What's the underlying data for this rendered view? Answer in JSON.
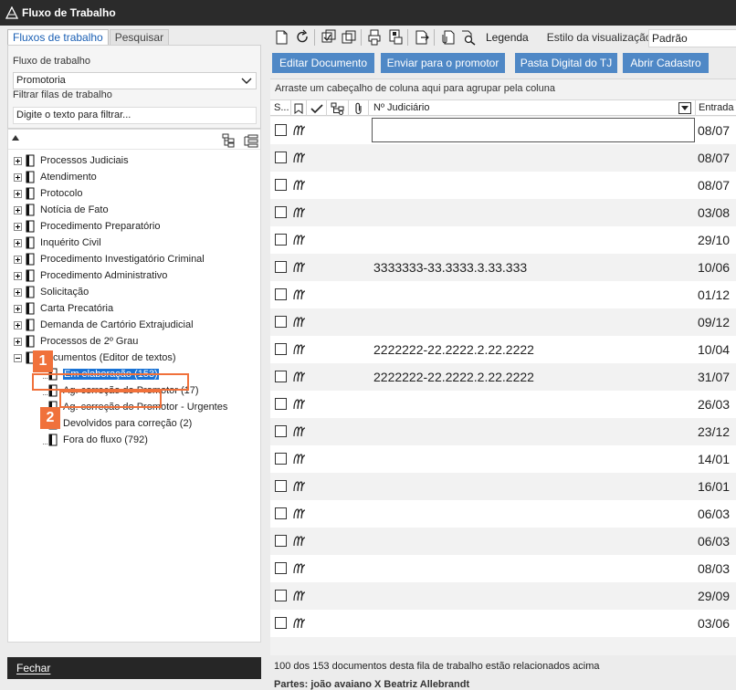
{
  "window": {
    "title": "Fluxo de Trabalho"
  },
  "left": {
    "tabs": [
      "Fluxos de trabalho",
      "Pesquisar"
    ],
    "workflow_label": "Fluxo de trabalho",
    "workflow_value": "Promotoria",
    "filter_label": "Filtrar filas de trabalho",
    "filter_placeholder": "Digite o texto para filtrar...",
    "tree": [
      "Processos Judiciais",
      "Atendimento",
      "Protocolo",
      "Notícia de Fato",
      "Procedimento Preparatório",
      "Inquérito Civil",
      "Procedimento Investigatório Criminal",
      "Procedimento Administrativo",
      "Solicitação",
      "Carta Precatória",
      "Demanda de Cartório Extrajudicial",
      "Processos de 2º Grau",
      "Documentos (Editor de textos)"
    ],
    "subtree": [
      "Em elaboração (153)",
      "Ag. correção do Promotor (17)",
      "Ag. correção do Promotor - Urgentes",
      "Devolvidos para correção (2)",
      "Fora do fluxo (792)"
    ],
    "badges": [
      "1",
      "2"
    ],
    "close_label": "Fechar"
  },
  "right": {
    "toolbar": {
      "legend": "Legenda",
      "view_style_label": "Estilo da visualização",
      "view_style_value": "Padrão"
    },
    "actions": [
      "Editar Documento",
      "Enviar para o promotor",
      "Pasta Digital do TJ",
      "Abrir Cadastro"
    ],
    "group_hint": "Arraste um cabeçalho de coluna aqui para agrupar pela coluna",
    "columns": {
      "s": "S...",
      "proc": "Nº Judiciário",
      "entrada": "Entrada"
    },
    "rows": [
      {
        "proc": "",
        "date": "08/07"
      },
      {
        "proc": "",
        "date": "08/07"
      },
      {
        "proc": "",
        "date": "08/07"
      },
      {
        "proc": "",
        "date": "03/08"
      },
      {
        "proc": "",
        "date": "29/10"
      },
      {
        "proc": "3333333-33.3333.3.33.333",
        "date": "10/06"
      },
      {
        "proc": "",
        "date": "01/12"
      },
      {
        "proc": "",
        "date": "09/12"
      },
      {
        "proc": "2222222-22.2222.2.22.2222",
        "date": "10/04"
      },
      {
        "proc": "2222222-22.2222.2.22.2222",
        "date": "31/07"
      },
      {
        "proc": "",
        "date": "26/03"
      },
      {
        "proc": "",
        "date": "23/12"
      },
      {
        "proc": "",
        "date": "14/01"
      },
      {
        "proc": "",
        "date": "16/01"
      },
      {
        "proc": "",
        "date": "06/03"
      },
      {
        "proc": "",
        "date": "06/03"
      },
      {
        "proc": "",
        "date": "08/03"
      },
      {
        "proc": "",
        "date": "29/09"
      },
      {
        "proc": "",
        "date": "03/06"
      }
    ],
    "status": "100 dos 153 documentos desta fila de trabalho estão relacionados acima",
    "partes": "Partes: joão avaiano  X  Beatriz Allebrandt"
  }
}
